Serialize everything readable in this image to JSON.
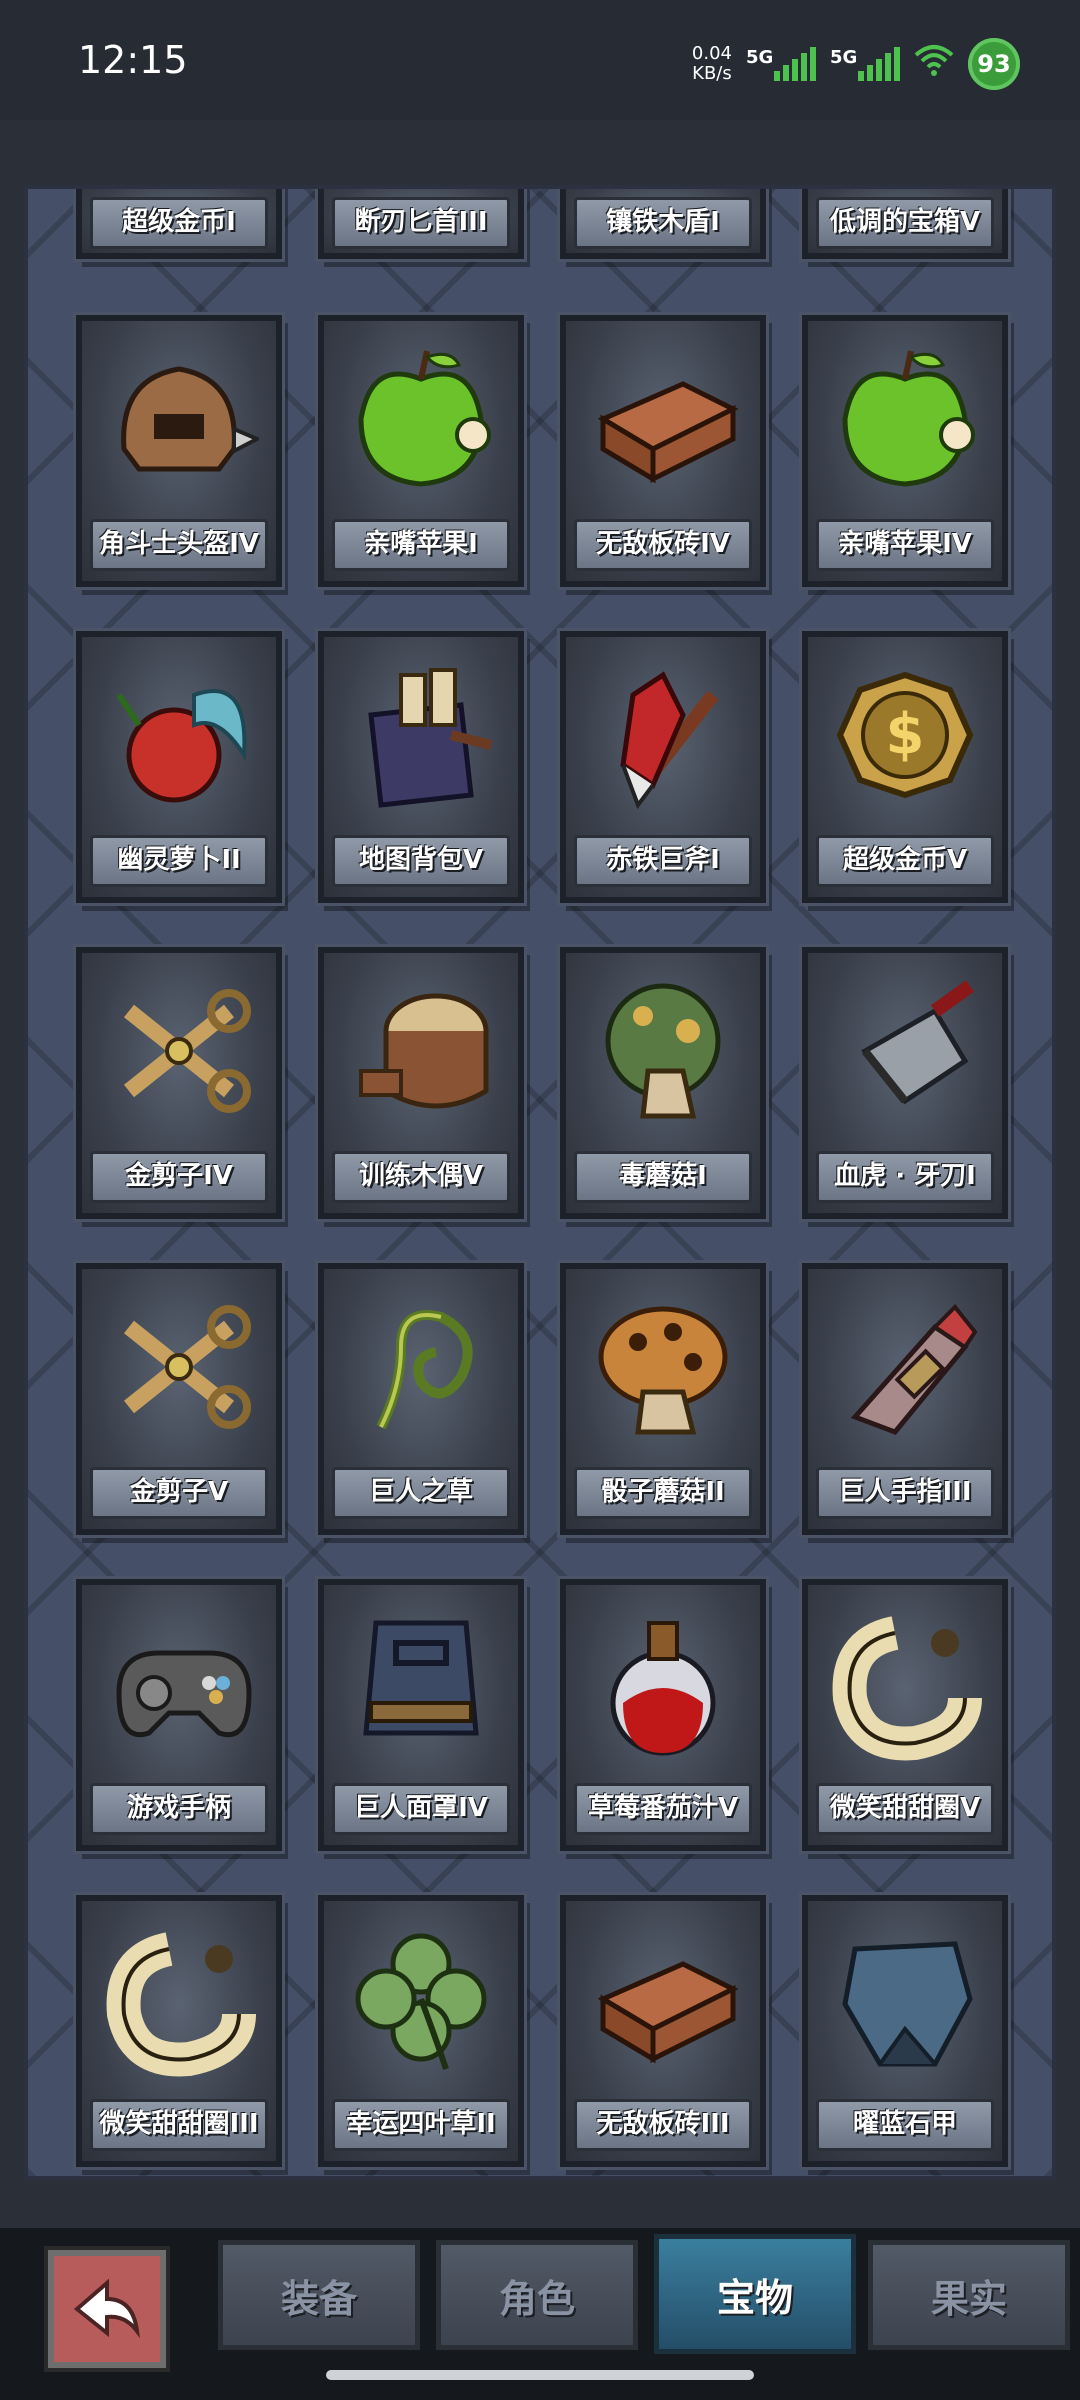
{
  "status": {
    "time": "12:15",
    "netspeed_value": "0.04",
    "netspeed_unit": "KB/s",
    "signal1": "5G",
    "signal2": "5G",
    "battery": "93"
  },
  "partial_row": [
    {
      "name": "超级金币I"
    },
    {
      "name": "断刃匕首III"
    },
    {
      "name": "镶铁木盾I"
    },
    {
      "name": "低调的宝箱V"
    }
  ],
  "items": [
    {
      "name": "角斗士头盔IV",
      "icon": "helmet-icon"
    },
    {
      "name": "亲嘴苹果I",
      "icon": "apple-icon"
    },
    {
      "name": "无敌板砖IV",
      "icon": "brick-icon"
    },
    {
      "name": "亲嘴苹果IV",
      "icon": "apple-icon"
    },
    {
      "name": "幽灵萝卜II",
      "icon": "radish-icon"
    },
    {
      "name": "地图背包V",
      "icon": "map-bag-icon"
    },
    {
      "name": "赤铁巨斧I",
      "icon": "axe-icon"
    },
    {
      "name": "超级金币V",
      "icon": "gold-coin-icon"
    },
    {
      "name": "金剪子IV",
      "icon": "scissors-icon"
    },
    {
      "name": "训练木偶V",
      "icon": "wooden-dummy-icon"
    },
    {
      "name": "毒蘑菇I",
      "icon": "poison-mushroom-icon"
    },
    {
      "name": "血虎 · 牙刀I",
      "icon": "cleaver-icon"
    },
    {
      "name": "金剪子V",
      "icon": "scissors-icon"
    },
    {
      "name": "巨人之草",
      "icon": "giant-grass-icon"
    },
    {
      "name": "骰子蘑菇II",
      "icon": "dice-mushroom-icon"
    },
    {
      "name": "巨人手指III",
      "icon": "giant-finger-icon"
    },
    {
      "name": "游戏手柄",
      "icon": "gamepad-icon"
    },
    {
      "name": "巨人面罩IV",
      "icon": "giant-mask-icon"
    },
    {
      "name": "草莓番茄汁V",
      "icon": "potion-icon"
    },
    {
      "name": "微笑甜甜圈V",
      "icon": "donut-icon"
    },
    {
      "name": "微笑甜甜圈III",
      "icon": "donut-icon"
    },
    {
      "name": "幸运四叶草II",
      "icon": "clover-icon"
    },
    {
      "name": "无敌板砖III",
      "icon": "brick-icon"
    },
    {
      "name": "曜蓝石甲",
      "icon": "armor-icon"
    }
  ],
  "tabs": [
    {
      "label": "装备",
      "active": false
    },
    {
      "label": "角色",
      "active": false
    },
    {
      "label": "宝物",
      "active": true
    },
    {
      "label": "果实",
      "active": false
    }
  ]
}
